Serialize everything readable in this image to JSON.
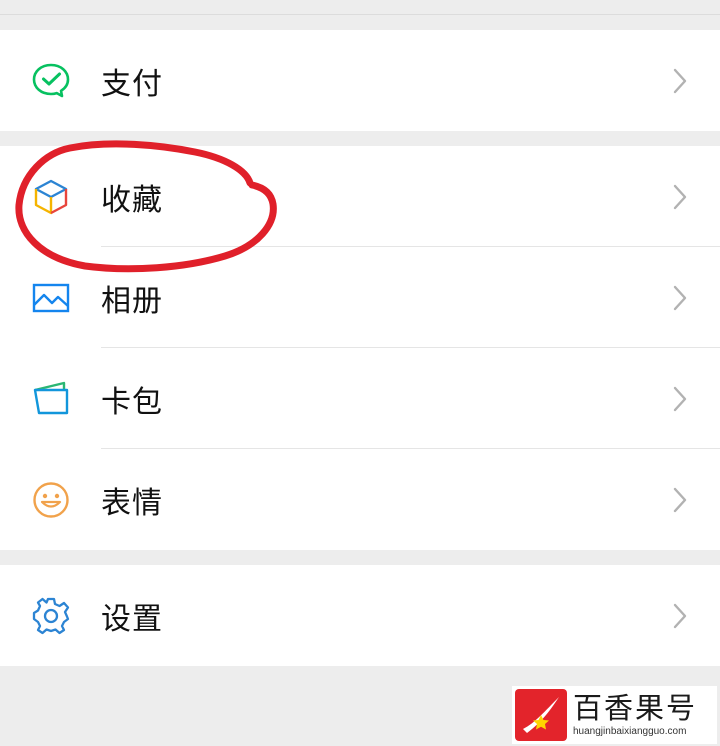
{
  "menu": {
    "pay": {
      "label": "支付",
      "icon": "wechat-pay-icon"
    },
    "favorites": {
      "label": "收藏",
      "icon": "cube-icon"
    },
    "album": {
      "label": "相册",
      "icon": "picture-icon"
    },
    "card": {
      "label": "卡包",
      "icon": "wallet-icon"
    },
    "stickers": {
      "label": "表情",
      "icon": "smiley-icon"
    },
    "settings": {
      "label": "设置",
      "icon": "gear-icon"
    }
  },
  "colors": {
    "pay_green": "#07c160",
    "album_blue": "#1485ee",
    "card_blue": "#1296db",
    "card_green": "#2bb673",
    "sticker_orange": "#f1a24b",
    "settings_blue": "#2c84d3",
    "annotation_red": "#e0202a"
  },
  "watermark": {
    "name": "百香果号",
    "url": "huangjinbaixiangguo.com"
  }
}
